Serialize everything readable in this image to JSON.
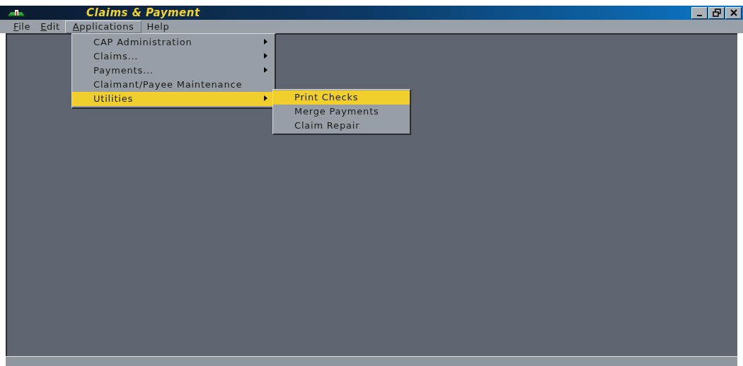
{
  "window": {
    "title": "Claims & Payment",
    "controls": [
      {
        "kind": "minimize"
      },
      {
        "kind": "restore"
      },
      {
        "kind": "close"
      }
    ]
  },
  "menubar": [
    {
      "label": "File",
      "mnemonic": true,
      "selected": false
    },
    {
      "label": "Edit",
      "mnemonic": true,
      "selected": false
    },
    {
      "label": "Applications",
      "mnemonic": true,
      "selected": true
    },
    {
      "label": "Help",
      "mnemonic": false,
      "selected": false
    }
  ],
  "applications_menu": [
    {
      "label": "CAP Administration",
      "has_submenu": true,
      "selected": false
    },
    {
      "label": "Claims...",
      "has_submenu": true,
      "selected": false
    },
    {
      "label": "Payments...",
      "has_submenu": true,
      "selected": false
    },
    {
      "label": "Claimant/Payee Maintenance",
      "has_submenu": false,
      "selected": false
    },
    {
      "label": "Utilities",
      "has_submenu": true,
      "selected": true
    }
  ],
  "utilities_menu": [
    {
      "label": "Print Checks",
      "selected": true
    },
    {
      "label": "Merge Payments",
      "selected": false
    },
    {
      "label": "Claim Repair",
      "selected": false
    }
  ]
}
